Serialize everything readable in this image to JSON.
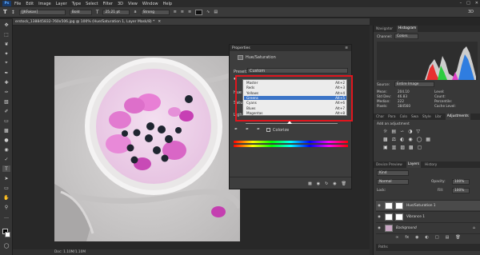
{
  "menu": {
    "logo": "Ps",
    "items": [
      "File",
      "Edit",
      "Image",
      "Layer",
      "Type",
      "Select",
      "Filter",
      "3D",
      "View",
      "Window",
      "Help"
    ]
  },
  "options": {
    "font": "[JKFakan]",
    "style": "Bold",
    "size": "25.21 pt",
    "aa": "Strong"
  },
  "doc_tab": "erstock_138845832-760x506.jpg @ 100% (Hue/Saturation 1, Layer Mask/8) *",
  "status": "Doc: 1.10M/1.10M",
  "properties": {
    "title": "Properties",
    "adj": "Hue/Saturation",
    "preset_label": "Preset:",
    "preset_value": "Custom",
    "colorize": "Colorize",
    "items": [
      {
        "name": "Master",
        "key": "Alt+2"
      },
      {
        "name": "Reds",
        "key": "Alt+3"
      },
      {
        "name": "Yellows",
        "key": "Alt+4"
      },
      {
        "name": "Greens",
        "key": "Alt+5"
      },
      {
        "name": "Cyans",
        "key": "Alt+6"
      },
      {
        "name": "Blues",
        "key": "Alt+7"
      },
      {
        "name": "Magentas",
        "key": "Alt+8"
      }
    ],
    "side": [
      "Hue",
      "Satu",
      "Light"
    ]
  },
  "navigator": {
    "tabs": [
      "Navigator",
      "Histogram"
    ],
    "channel_label": "Channel:",
    "channel": "Colors",
    "source_label": "Source:",
    "source": "Entire Image",
    "stats": [
      {
        "l": "Mean:",
        "v": "204.10"
      },
      {
        "l": "Std Dev:",
        "v": "46.83"
      },
      {
        "l": "Median:",
        "v": "222"
      },
      {
        "l": "Pixels:",
        "v": "384560"
      }
    ],
    "stats2": [
      "Level:",
      "Count:",
      "Percentile:",
      "Cache Level:"
    ]
  },
  "adjust": {
    "tabs": [
      "Char",
      "Para",
      "Colo",
      "Swa",
      "Style",
      "Libr",
      "Adjustments"
    ],
    "title": "Add an adjustment"
  },
  "layers": {
    "tabs": [
      "Device Preview",
      "Layers",
      "History"
    ],
    "kind": "Kind",
    "mode": "Normal",
    "opacity_label": "Opacity:",
    "opacity": "100%",
    "lock_label": "Lock:",
    "fill_label": "Fill:",
    "fill": "100%",
    "items": [
      {
        "name": "Hue/Saturation 1"
      },
      {
        "name": "Vibrance 1"
      },
      {
        "name": "Background"
      }
    ]
  },
  "colors": {
    "accent": "#3b74c7",
    "highlight": "#e0161e"
  }
}
